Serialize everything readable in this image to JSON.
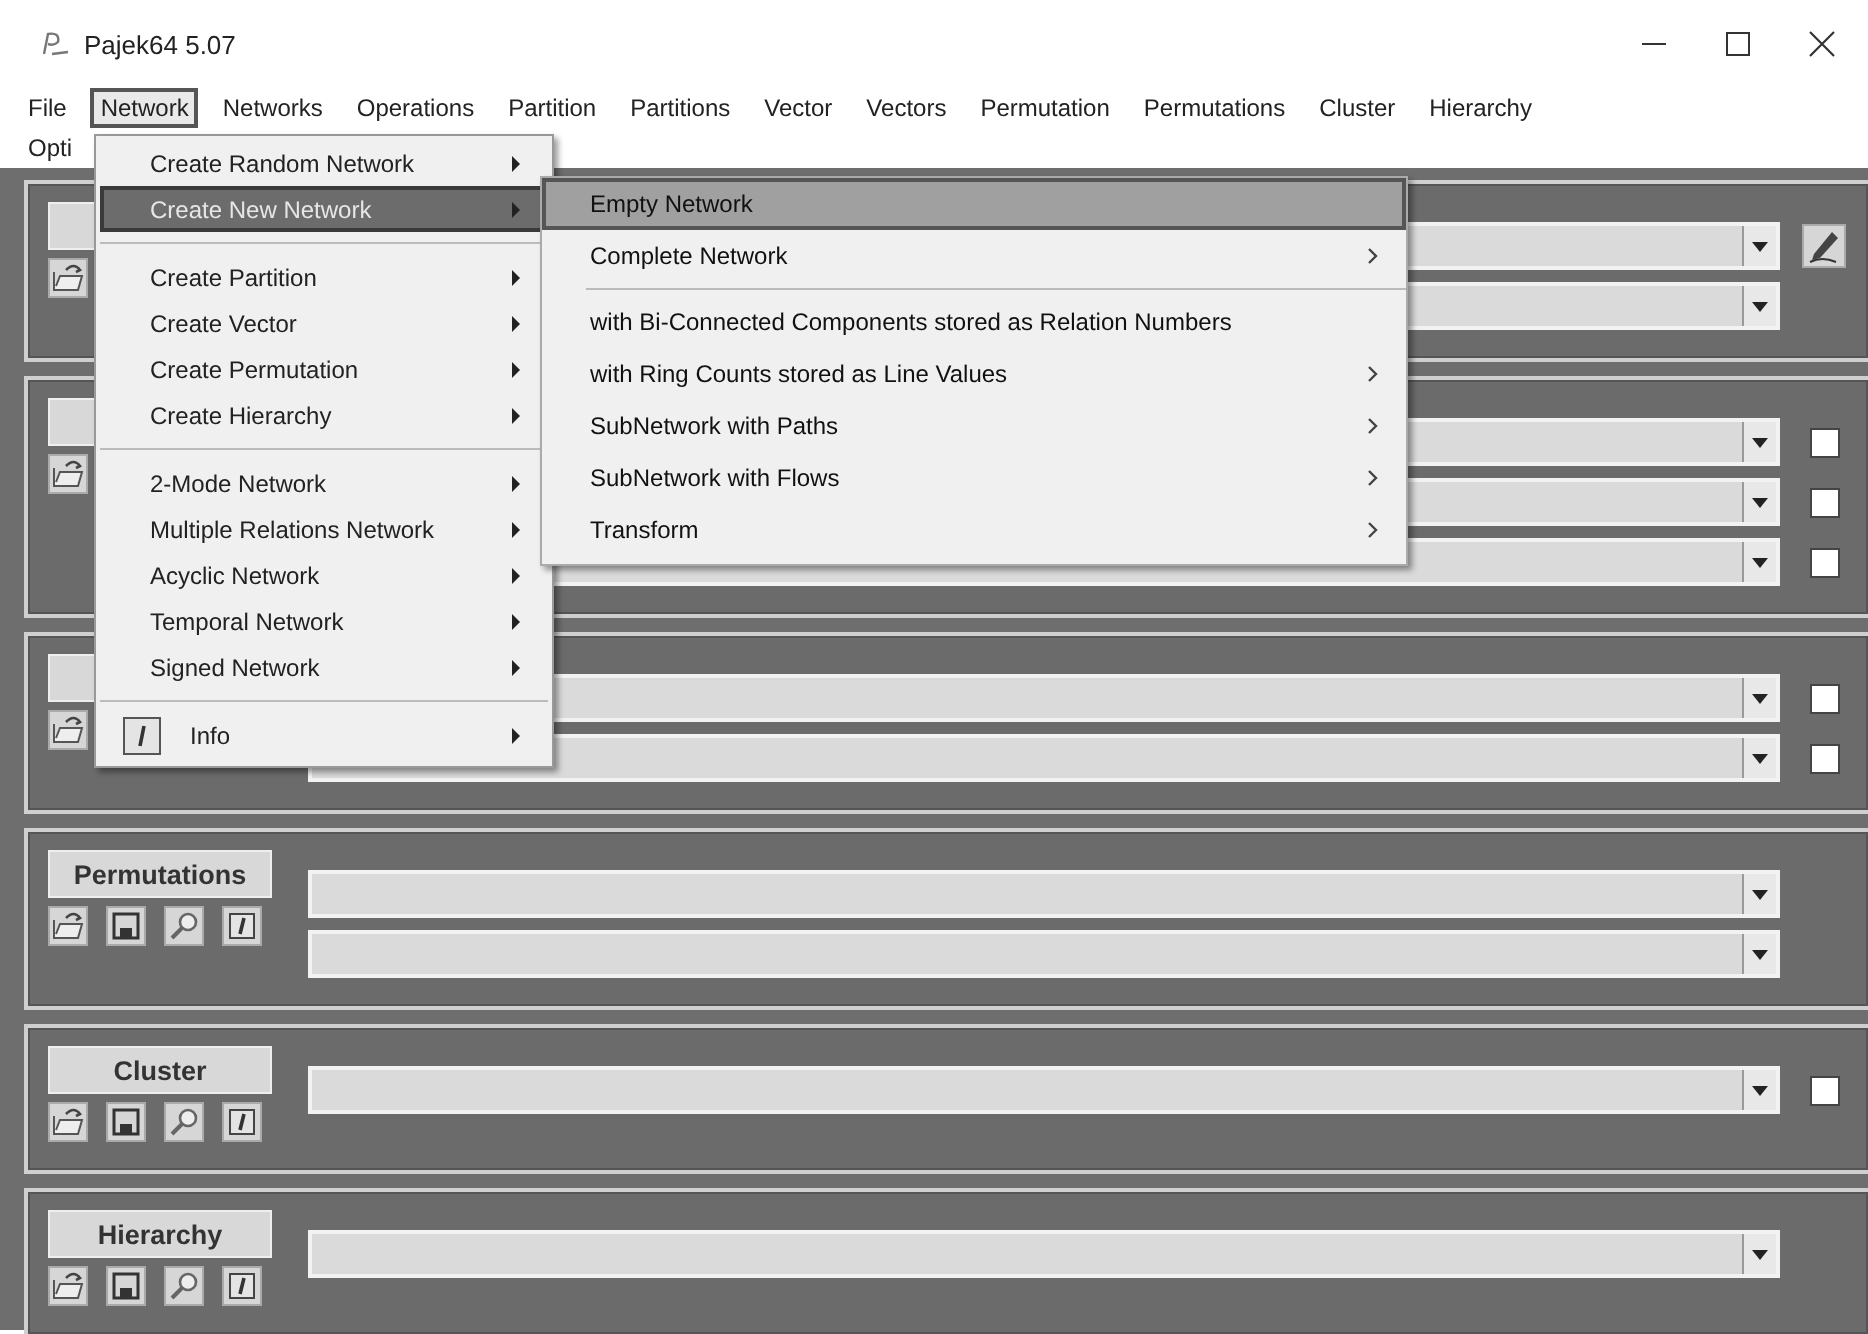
{
  "window": {
    "title": "Pajek64 5.07"
  },
  "menu_bar": {
    "rows": [
      [
        {
          "label": "File",
          "selected": false
        },
        {
          "label": "Network",
          "selected": true
        },
        {
          "label": "Networks",
          "selected": false
        },
        {
          "label": "Operations",
          "selected": false
        },
        {
          "label": "Partition",
          "selected": false
        },
        {
          "label": "Partitions",
          "selected": false
        },
        {
          "label": "Vector",
          "selected": false
        },
        {
          "label": "Vectors",
          "selected": false
        },
        {
          "label": "Permutation",
          "selected": false
        },
        {
          "label": "Permutations",
          "selected": false
        },
        {
          "label": "Cluster",
          "selected": false
        },
        {
          "label": "Hierarchy",
          "selected": false
        }
      ],
      [
        {
          "label": "Opti",
          "selected": false
        }
      ]
    ]
  },
  "menu": {
    "items": [
      {
        "kind": "item",
        "label": "Create Random Network",
        "submenu": true,
        "selected": false
      },
      {
        "kind": "item",
        "label": "Create New Network",
        "submenu": true,
        "selected": true
      },
      {
        "kind": "separator"
      },
      {
        "kind": "item",
        "label": "Create Partition",
        "submenu": true,
        "selected": false
      },
      {
        "kind": "item",
        "label": "Create Vector",
        "submenu": true,
        "selected": false
      },
      {
        "kind": "item",
        "label": "Create Permutation",
        "submenu": true,
        "selected": false
      },
      {
        "kind": "item",
        "label": "Create Hierarchy",
        "submenu": true,
        "selected": false
      },
      {
        "kind": "separator"
      },
      {
        "kind": "item",
        "label": "2-Mode Network",
        "submenu": true,
        "selected": false
      },
      {
        "kind": "item",
        "label": "Multiple Relations Network",
        "submenu": true,
        "selected": false
      },
      {
        "kind": "item",
        "label": "Acyclic Network",
        "submenu": true,
        "selected": false
      },
      {
        "kind": "item",
        "label": "Temporal Network",
        "submenu": true,
        "selected": false
      },
      {
        "kind": "item",
        "label": "Signed Network",
        "submenu": true,
        "selected": false
      },
      {
        "kind": "separator"
      },
      {
        "kind": "icon_item",
        "label": "Info",
        "submenu": true,
        "selected": false
      }
    ]
  },
  "submenu": {
    "items": [
      {
        "kind": "item",
        "label": "Empty Network",
        "submenu": false,
        "selected": true
      },
      {
        "kind": "item",
        "label": "Complete Network",
        "submenu": true,
        "selected": false
      },
      {
        "kind": "separator"
      },
      {
        "kind": "item",
        "label": "with Bi-Connected Components stored as Relation Numbers",
        "submenu": false,
        "selected": false
      },
      {
        "kind": "item",
        "label": "with Ring Counts stored as Line Values",
        "submenu": true,
        "selected": false
      },
      {
        "kind": "item",
        "label": "SubNetwork with Paths",
        "submenu": true,
        "selected": false
      },
      {
        "kind": "item",
        "label": "SubNetwork with Flows",
        "submenu": true,
        "selected": false
      },
      {
        "kind": "item",
        "label": "Transform",
        "submenu": true,
        "selected": false
      }
    ]
  },
  "panels": [
    {
      "icons": [
        {
          "kind": "open"
        }
      ],
      "rows": [
        {
          "kind": "dropdown_pencil"
        },
        {
          "kind": "dropdown"
        }
      ]
    },
    {
      "icons": [
        {
          "kind": "open"
        }
      ],
      "rows": [
        {
          "kind": "dropdown_checkbox",
          "checked": false
        },
        {
          "kind": "dropdown_checkbox",
          "checked": false
        },
        {
          "kind": "dropdown_checkbox",
          "checked": false
        }
      ]
    },
    {
      "icons": [
        {
          "kind": "open"
        }
      ],
      "rows": [
        {
          "kind": "dropdown_checkbox",
          "checked": false
        },
        {
          "kind": "dropdown_checkbox",
          "checked": false
        }
      ]
    },
    {
      "label": "Permutations",
      "icons": [
        {
          "kind": "open"
        },
        {
          "kind": "save"
        },
        {
          "kind": "search"
        },
        {
          "kind": "info"
        }
      ],
      "rows": [
        {
          "kind": "dropdown"
        },
        {
          "kind": "dropdown"
        }
      ]
    },
    {
      "label": "Cluster",
      "icons": [
        {
          "kind": "open"
        },
        {
          "kind": "save"
        },
        {
          "kind": "search"
        },
        {
          "kind": "info"
        }
      ],
      "rows": [
        {
          "kind": "dropdown_checkbox",
          "checked": false
        }
      ]
    },
    {
      "label": "Hierarchy",
      "icons": [
        {
          "kind": "open"
        },
        {
          "kind": "save"
        },
        {
          "kind": "search"
        },
        {
          "kind": "info"
        }
      ],
      "rows": [
        {
          "kind": "dropdown"
        }
      ]
    }
  ]
}
